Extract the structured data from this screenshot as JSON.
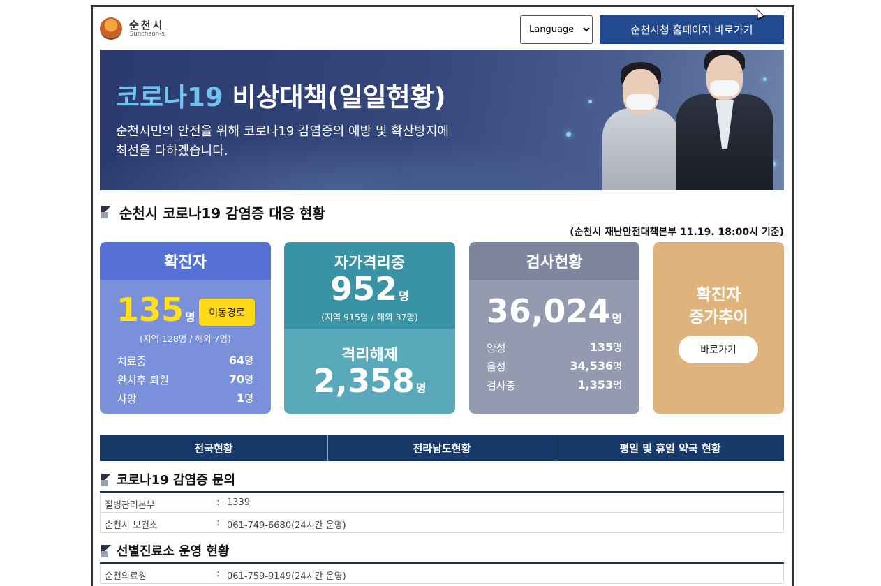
{
  "header": {
    "logo_name": "순천시",
    "logo_sub": "Suncheon-si",
    "language": {
      "selected": "Language",
      "options": [
        "Language"
      ]
    },
    "home_button": "순천시청 홈페이지 바로가기"
  },
  "banner": {
    "title_highlight": "코로나19",
    "title_rest": " 비상대책(일일현황)",
    "desc_line1": "순천시민의 안전을 위해 코로나19 감염증의 예방 및 확산방지에",
    "desc_line2": "최선을 다하겠습니다."
  },
  "status_section": {
    "title": "순천시 코로나19 감염증 대응 현황",
    "basis": "(순천시 재난안전대책본부 11.19. 18:00시 기준)"
  },
  "confirmed": {
    "label": "확진자",
    "count": "135",
    "unit": "명",
    "route_button": "이동경로",
    "breakdown": "(지역 128명 / 해외 7명)",
    "rows": [
      {
        "key": "치료중",
        "value": "64",
        "unit": "명"
      },
      {
        "key": "완치후 퇴원",
        "value": "70",
        "unit": "명"
      },
      {
        "key": "사망",
        "value": "1",
        "unit": "명"
      }
    ]
  },
  "quarantine": {
    "label": "자가격리중",
    "count": "952",
    "unit": "명",
    "breakdown": "(지역 915명 / 해외 37명)",
    "released_label": "격리해제",
    "released_count": "2,358",
    "released_unit": "명"
  },
  "tests": {
    "label": "검사현황",
    "count": "36,024",
    "unit": "명",
    "rows": [
      {
        "key": "양성",
        "value": "135",
        "unit": "명"
      },
      {
        "key": "음성",
        "value": "34,536",
        "unit": "명"
      },
      {
        "key": "검사중",
        "value": "1,353",
        "unit": "명"
      }
    ]
  },
  "trend": {
    "label_line1": "확진자",
    "label_line2": "증가추이",
    "button": "바로가기"
  },
  "tabs": [
    "전국현황",
    "전라남도현황",
    "평일 및 휴일 약국 현황"
  ],
  "inquiry": {
    "title": "코로나19 감염증 문의",
    "rows": [
      {
        "key": "질병관리본부",
        "sep": ":",
        "value": "1339"
      },
      {
        "key": "순천시 보건소",
        "sep": ":",
        "value": "061-749-6680(24시간 운영)"
      }
    ]
  },
  "clinic": {
    "title": "선별진료소 운영 현황",
    "rows": [
      {
        "key": "순천의료원",
        "sep": ":",
        "value": "061-759-9149(24시간 운영)"
      }
    ]
  },
  "colors": {
    "navy": "#173a6b",
    "confirmed_blue": "#5570d4",
    "quarantine_teal": "#3a92a5",
    "tests_gray": "#7d849e",
    "trend_tan": "#dfb47c",
    "highlight_yellow": "#ffe01a"
  }
}
